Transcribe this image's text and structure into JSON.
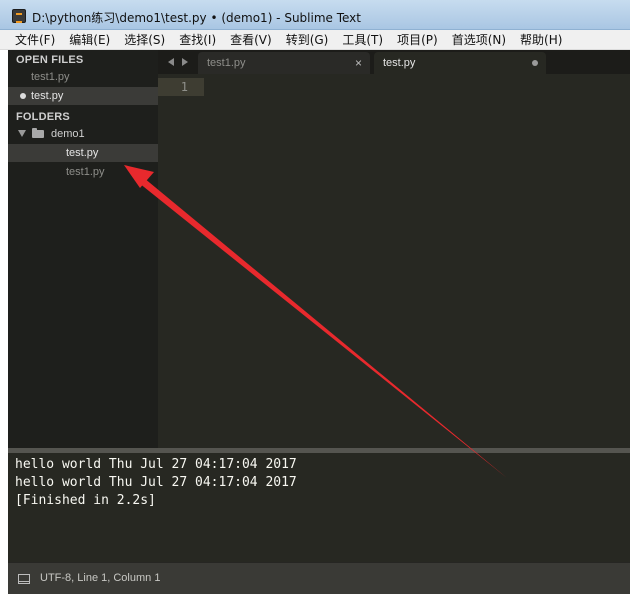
{
  "window": {
    "title": "D:\\python练习\\demo1\\test.py • (demo1) - Sublime Text",
    "icon": "sublime-text-icon"
  },
  "menu": [
    {
      "label": "文件(F)"
    },
    {
      "label": "编辑(E)"
    },
    {
      "label": "选择(S)"
    },
    {
      "label": "查找(I)"
    },
    {
      "label": "查看(V)"
    },
    {
      "label": "转到(G)"
    },
    {
      "label": "工具(T)"
    },
    {
      "label": "项目(P)"
    },
    {
      "label": "首选项(N)"
    },
    {
      "label": "帮助(H)"
    }
  ],
  "sidebar": {
    "open_files_heading": "OPEN FILES",
    "open_files": [
      {
        "label": "test1.py",
        "selected": false,
        "dirty": false
      },
      {
        "label": "test.py",
        "selected": true,
        "dirty": true
      }
    ],
    "folders_heading": "FOLDERS",
    "folder": {
      "label": "demo1",
      "expanded": true
    },
    "folder_files": [
      {
        "label": "test.py",
        "selected": true
      },
      {
        "label": "test1.py",
        "selected": false
      }
    ]
  },
  "tabs": [
    {
      "label": "test1.py",
      "active": false,
      "close_glyph": "×"
    },
    {
      "label": "test.py",
      "active": true,
      "dirty": true
    }
  ],
  "editor": {
    "line_numbers": [
      "1"
    ],
    "lines": [
      ""
    ]
  },
  "output": {
    "lines": [
      "hello world Thu Jul 27 04:17:04 2017",
      "hello world Thu Jul 27 04:17:04 2017",
      "[Finished in 2.2s]"
    ]
  },
  "status": {
    "text": "UTF-8, Line 1, Column 1"
  },
  "colors": {
    "sidebar_bg": "#1e1f1c",
    "editor_bg": "#272822",
    "annotation_arrow": "#e8292d"
  }
}
